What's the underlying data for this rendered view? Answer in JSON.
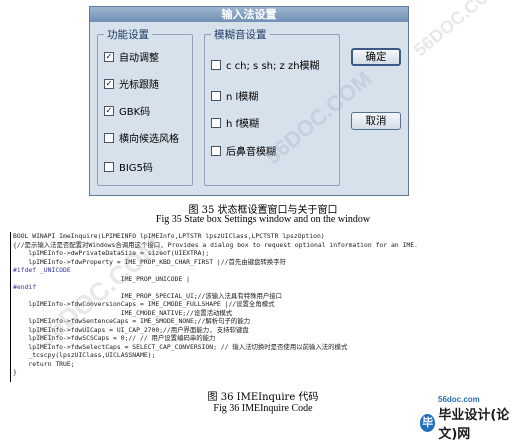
{
  "dialog": {
    "title": "输入法设置",
    "left_group": {
      "label": "功能设置",
      "options": [
        {
          "label": "自动调整",
          "checked": true
        },
        {
          "label": "光标跟随",
          "checked": true
        },
        {
          "label": "GBK码",
          "checked": true
        },
        {
          "label": "横向候选风格",
          "checked": false
        },
        {
          "label": "BIG5码",
          "checked": false
        }
      ]
    },
    "right_group": {
      "label": "模糊音设置",
      "options": [
        {
          "label": "c ch; s sh; z zh模糊",
          "checked": false
        },
        {
          "label": "n l模糊",
          "checked": false
        },
        {
          "label": "h f模糊",
          "checked": false
        },
        {
          "label": "后鼻音模糊",
          "checked": false
        }
      ]
    },
    "ok_label": "确定",
    "cancel_label": "取消"
  },
  "captions": {
    "fig35_zh": "图  35  状态框设置窗口与关于窗口",
    "fig35_en": "Fig 35 State box Settings window and on the window",
    "fig36_zh": "图  36 IMEInquire 代码",
    "fig36_en": "Fig 36 IMEInquire Code"
  },
  "code_lines": [
    "BOOL WINAPI ImeInquire(LPIMEINFO lpIMEInfo,LPTSTR lpszUIClass,LPCTSTR lpszOption)",
    "{//是示输入法是否配置对Windows合调用这个接口, Provides a dialog box to request optional information for an IME.",
    "    lpIMEInfo->dwPrivateDataSize = sizeof(UIEXTRA);",
    "    lpIMEInfo->fdwProperty = IME_PROP_KBD_CHAR_FIRST |//首先由键盘转换字符",
    "#ifdef _UNICODE",
    "                            IME_PROP_UNICODE |",
    "#endif",
    "                            IME_PROP_SPECIAL_UI;//该输入法具有特殊用户接口",
    "    lpIMEInfo->fdwConversionCaps = IME_CMODE_FULLSHAPE |//设置全角模式",
    "                            IME_CMODE_NATIVE;//设置活动模式",
    "    lpIMEInfo->fdwSentenceCaps = IME_SMODE_NONE;//解析句子的能力",
    "    lpIMEInfo->fdwUICaps = UI_CAP_2700;//用户界面能力, 支持软键盘",
    "    lpIMEInfo->fdwSCSCaps = 0;// // 用户设置编码串的能力",
    "    lpIMEInfo->fdwSelectCaps = SELECT_CAP_CONVERSION; // 输入法切换时是否使用以前输入法的模式",
    "    _tcscpy(lpszUIClass,UICLASSNAME);",
    "    return TRUE;",
    "}"
  ],
  "watermark": "56DOC.COM",
  "logo": {
    "url": "56doc.com",
    "text": "毕业设计(论文)网",
    "mark": "毕",
    "color": "#1f6fbf"
  }
}
